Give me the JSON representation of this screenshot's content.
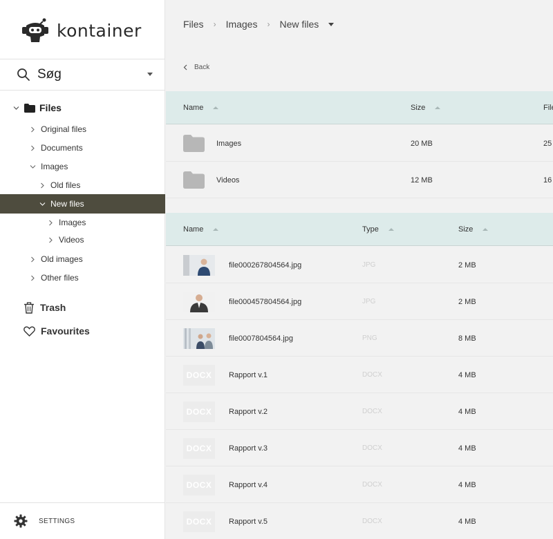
{
  "app": {
    "name": "kontainer"
  },
  "search": {
    "label": "Søg"
  },
  "tree": {
    "root": "Files",
    "items": [
      {
        "label": "Original files"
      },
      {
        "label": "Documents"
      },
      {
        "label": "Images"
      },
      {
        "label": "Old files"
      },
      {
        "label": "New files"
      },
      {
        "label": "Images"
      },
      {
        "label": "Videos"
      },
      {
        "label": "Old images"
      },
      {
        "label": "Other files"
      }
    ]
  },
  "nav": {
    "trash": "Trash",
    "favourites": "Favourites"
  },
  "settings": {
    "label": "SETTINGS"
  },
  "breadcrumb": {
    "items": [
      "Files",
      "Images",
      "New files"
    ]
  },
  "back": {
    "label": "Back"
  },
  "folders": {
    "headers": {
      "name": "Name",
      "size": "Size",
      "files": "Files"
    },
    "rows": [
      {
        "name": "Images",
        "size": "20 MB",
        "files": "25"
      },
      {
        "name": "Videos",
        "size": "12 MB",
        "files": "16"
      }
    ]
  },
  "files": {
    "headers": {
      "name": "Name",
      "type": "Type",
      "size": "Size"
    },
    "rows": [
      {
        "thumb": "JPG",
        "name": "file000267804564.jpg",
        "type": "JPG",
        "size": "2 MB"
      },
      {
        "thumb": "JPG",
        "name": "file000457804564.jpg",
        "type": "JPG",
        "size": "2 MB"
      },
      {
        "thumb": "PNG",
        "name": "file0007804564.jpg",
        "type": "PNG",
        "size": "8 MB"
      },
      {
        "thumb": "DOCX",
        "name": "Rapport v.1",
        "type": "DOCX",
        "size": "4 MB"
      },
      {
        "thumb": "DOCX",
        "name": "Rapport v.2",
        "type": "DOCX",
        "size": "4 MB"
      },
      {
        "thumb": "DOCX",
        "name": "Rapport v.3",
        "type": "DOCX",
        "size": "4 MB"
      },
      {
        "thumb": "DOCX",
        "name": "Rapport v.4",
        "type": "DOCX",
        "size": "4 MB"
      },
      {
        "thumb": "DOCX",
        "name": "Rapport v.5",
        "type": "DOCX",
        "size": "4 MB"
      }
    ]
  },
  "colors": {
    "active": "#4e4c3e",
    "header_bg": "#ddebea",
    "background": "#f2f2f2"
  }
}
